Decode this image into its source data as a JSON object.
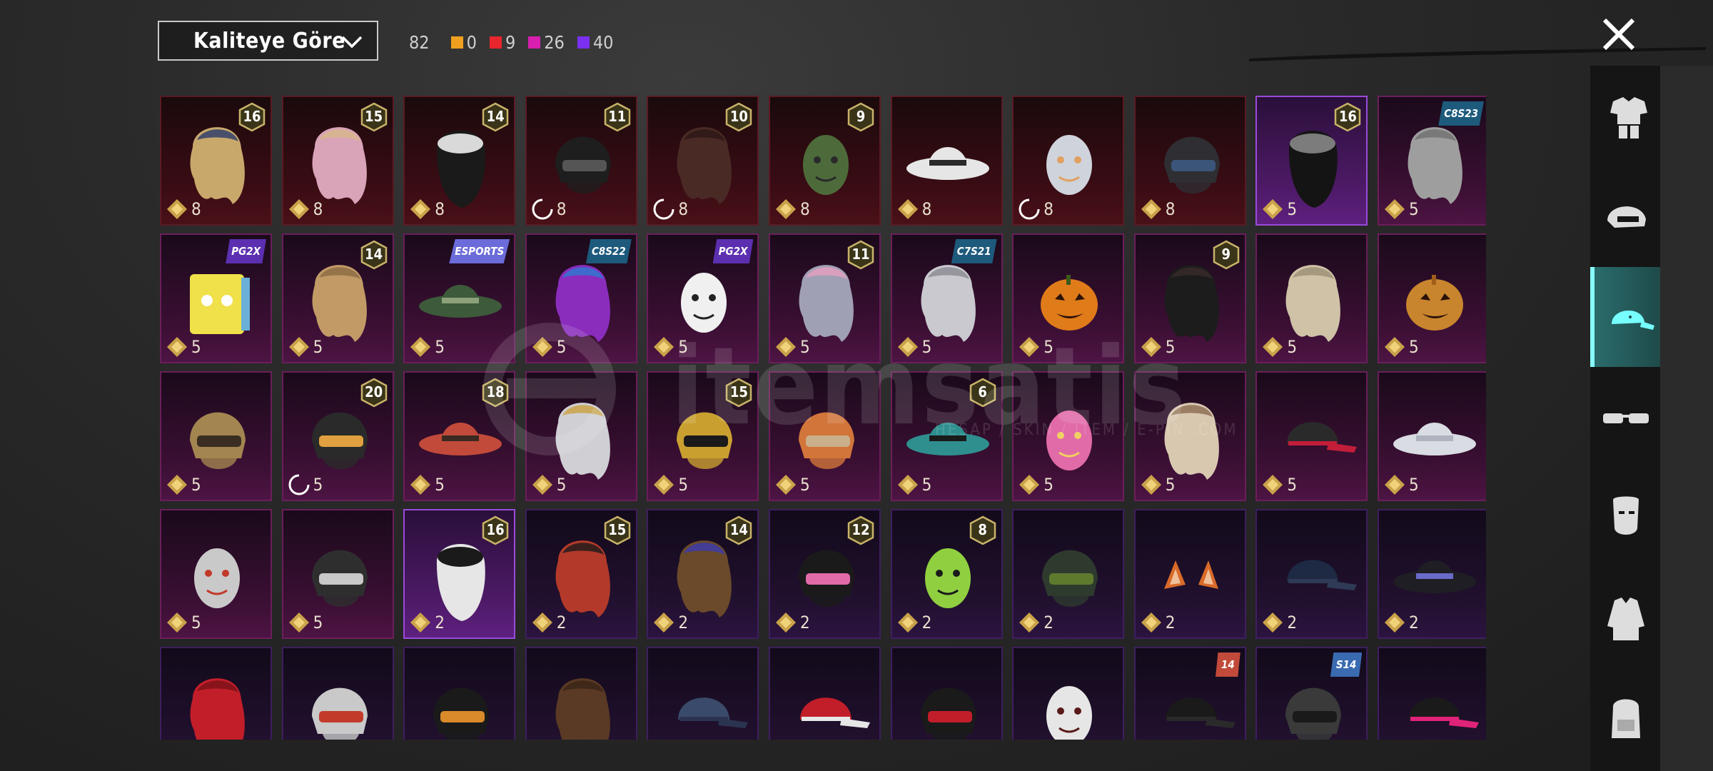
{
  "sort": {
    "label": "Kaliteye Göre"
  },
  "counts": {
    "total": "82",
    "qualities": [
      {
        "color": "#f0a020",
        "value": "0"
      },
      {
        "color": "#e8262c",
        "value": "9"
      },
      {
        "color": "#d81fb0",
        "value": "26"
      },
      {
        "color": "#7b2ff0",
        "value": "40"
      }
    ]
  },
  "watermark": {
    "text": "itemsatis",
    "sub": "HESAP / SKIN / İTEM / E-PİN .COM"
  },
  "sidebar": [
    {
      "icon": "outfit-icon",
      "active": false
    },
    {
      "icon": "helmet-icon",
      "active": false
    },
    {
      "icon": "cap-icon",
      "active": true
    },
    {
      "icon": "glasses-icon",
      "active": false
    },
    {
      "icon": "mask-icon",
      "active": false
    },
    {
      "icon": "jacket-icon",
      "active": false
    },
    {
      "icon": "backpack-icon",
      "active": false
    }
  ],
  "items": [
    {
      "name": "aviator-goggles-hair",
      "rarity": "red",
      "badge": "16",
      "price": "8",
      "art": "hair",
      "c1": "#c9a86b",
      "c2": "#2b3a6b"
    },
    {
      "name": "pink-long-hair",
      "rarity": "red",
      "badge": "15",
      "price": "8",
      "art": "hair",
      "c1": "#d9a3b8",
      "c2": "#d7b88a"
    },
    {
      "name": "wolf-ear-hood",
      "rarity": "red",
      "badge": "14",
      "price": "8",
      "art": "hood",
      "c1": "#1a1a1a",
      "c2": "#d9d9d9"
    },
    {
      "name": "black-helmet",
      "rarity": "red",
      "badge": "11",
      "price": "8",
      "art": "helmet",
      "c1": "#1e1e1e",
      "c2": "#555",
      "loading": true
    },
    {
      "name": "dark-dread-hair",
      "rarity": "red",
      "badge": "10",
      "price": "8",
      "art": "hair",
      "c1": "#4a2a25",
      "c2": "#2a1714",
      "loading": true
    },
    {
      "name": "zombie-head",
      "rarity": "red",
      "badge": "9",
      "price": "8",
      "art": "face",
      "c1": "#4d6b3a",
      "c2": "#2a2a2a"
    },
    {
      "name": "white-cowboy-hat",
      "rarity": "red",
      "badge": "",
      "price": "8",
      "art": "hat",
      "c1": "#e6e6e6",
      "c2": "#2b2b2b"
    },
    {
      "name": "shark-crown",
      "rarity": "red",
      "badge": "",
      "price": "8",
      "art": "face",
      "c1": "#cfd3db",
      "c2": "#e0a060",
      "loading": true
    },
    {
      "name": "dark-visor-helmet",
      "rarity": "red",
      "badge": "",
      "price": "8",
      "art": "helmet",
      "c1": "#2e2e33",
      "c2": "#3b5578"
    },
    {
      "name": "officer-cap-hair",
      "rarity": "purple-sel",
      "badge": "16",
      "price": "5",
      "art": "hood",
      "c1": "#141414",
      "c2": "#7c7c7c"
    },
    {
      "name": "grey-bob-hair",
      "rarity": "magenta",
      "tag": "C8S23",
      "tagColor": "#1d5a7c",
      "price": "5",
      "art": "hair",
      "c1": "#9e9e9e",
      "c2": "#6f6f6f"
    },
    {
      "name": "pop-box-head",
      "rarity": "magenta",
      "tag": "PG2X",
      "tagColor": "#5c2fb0",
      "price": "5",
      "art": "box",
      "c1": "#f0e04a",
      "c2": "#6ab0d8"
    },
    {
      "name": "blonde-wavy-hair",
      "rarity": "magenta",
      "badge": "14",
      "price": "5",
      "art": "hair",
      "c1": "#c19a66",
      "c2": "#8b6a44"
    },
    {
      "name": "camo-bucket-hat",
      "rarity": "magenta",
      "tag": "ESPORTS",
      "tagColor": "#6b6bd9",
      "price": "5",
      "art": "hat",
      "c1": "#3d5a3a",
      "c2": "#8ca07a"
    },
    {
      "name": "neon-bob-hair",
      "rarity": "magenta",
      "tag": "C8S22",
      "tagColor": "#1d5a7c",
      "price": "5",
      "art": "hair",
      "c1": "#8a2dbd",
      "c2": "#2a7ad1"
    },
    {
      "name": "panda-head",
      "rarity": "magenta",
      "tag": "PG2X",
      "tagColor": "#5c2fb0",
      "price": "5",
      "art": "face",
      "c1": "#f0f0f0",
      "c2": "#222"
    },
    {
      "name": "flower-crown-hair",
      "rarity": "magenta",
      "badge": "11",
      "price": "5",
      "art": "hair",
      "c1": "#a0a0b5",
      "c2": "#e6a0c0"
    },
    {
      "name": "silver-short-hair",
      "rarity": "magenta",
      "tag": "C7S21",
      "tagColor": "#1d5a7c",
      "price": "5",
      "art": "hair",
      "c1": "#c9c9cf",
      "c2": "#8a8a92"
    },
    {
      "name": "pumpkin-head",
      "rarity": "magenta",
      "price": "5",
      "art": "pumpkin",
      "c1": "#e07b1a",
      "c2": "#3b5a1a"
    },
    {
      "name": "black-ponytail",
      "rarity": "magenta",
      "badge": "9",
      "price": "5",
      "art": "hair",
      "c1": "#1c1c1c",
      "c2": "#3a2a2a"
    },
    {
      "name": "braided-blonde-hair",
      "rarity": "magenta",
      "price": "5",
      "art": "hair",
      "c1": "#cfc2a6",
      "c2": "#9a8e76"
    },
    {
      "name": "potato-head",
      "rarity": "magenta",
      "price": "5",
      "art": "pumpkin",
      "c1": "#c9852e",
      "c2": "#a15e18"
    },
    {
      "name": "golden-horned-helmet",
      "rarity": "magenta",
      "price": "5",
      "art": "helmet",
      "c1": "#a38550",
      "c2": "#3a2e22"
    },
    {
      "name": "monkey-king-helmet",
      "rarity": "magenta",
      "badge": "20",
      "price": "5",
      "art": "helmet",
      "c1": "#2a2a2a",
      "c2": "#e0a040",
      "loading": true
    },
    {
      "name": "feather-headdress",
      "rarity": "magenta",
      "badge": "18",
      "price": "5",
      "art": "hat",
      "c1": "#c24a3a",
      "c2": "#3a2a22"
    },
    {
      "name": "crowned-white-hair",
      "rarity": "magenta",
      "price": "5",
      "art": "hair",
      "c1": "#cfcfd4",
      "c2": "#c9a040"
    },
    {
      "name": "golden-robot-helmet",
      "rarity": "magenta",
      "badge": "15",
      "price": "5",
      "art": "helmet",
      "c1": "#c9a030",
      "c2": "#1a1a1a"
    },
    {
      "name": "orange-horn-helmet",
      "rarity": "magenta",
      "price": "5",
      "art": "helmet",
      "c1": "#d2753a",
      "c2": "#c9b08a"
    },
    {
      "name": "teal-tree-hat",
      "rarity": "magenta",
      "badge": "6",
      "price": "5",
      "art": "hat",
      "c1": "#2f8f8f",
      "c2": "#1a1a1a"
    },
    {
      "name": "pink-bunny-head",
      "rarity": "magenta",
      "price": "5",
      "art": "face",
      "c1": "#e16aa8",
      "c2": "#f0d060"
    },
    {
      "name": "cream-fluffy-hair",
      "rarity": "magenta",
      "price": "5",
      "art": "hair",
      "c1": "#d9c8b0",
      "c2": "#8a6a50"
    },
    {
      "name": "red-beanie-cap",
      "rarity": "magenta",
      "price": "5",
      "art": "cap",
      "c1": "#2a2a2a",
      "c2": "#c21e3a"
    },
    {
      "name": "white-sun-hat",
      "rarity": "magenta",
      "price": "5",
      "art": "hat",
      "c1": "#d9dce3",
      "c2": "#aeb3bd"
    },
    {
      "name": "chicken-head",
      "rarity": "magenta",
      "price": "5",
      "art": "face",
      "c1": "#c9c9c9",
      "c2": "#c23a2a"
    },
    {
      "name": "skull-mask-helmet",
      "rarity": "magenta",
      "price": "5",
      "art": "helmet",
      "c1": "#2e2e2e",
      "c2": "#c9c9c9"
    },
    {
      "name": "bandana-mohawk",
      "rarity": "purple-sel",
      "badge": "16",
      "price": "2",
      "art": "hood",
      "c1": "#e6e6e6",
      "c2": "#1a1a1a"
    },
    {
      "name": "red-hair-hood",
      "rarity": "purple",
      "badge": "15",
      "price": "2",
      "art": "hair",
      "c1": "#b33a2a",
      "c2": "#1a1a1a"
    },
    {
      "name": "cat-ear-cap-hair",
      "rarity": "purple",
      "badge": "14",
      "price": "2",
      "art": "hair",
      "c1": "#6a4a2a",
      "c2": "#3a3ab0"
    },
    {
      "name": "bunny-ear-helmet",
      "rarity": "purple",
      "badge": "12",
      "price": "2",
      "art": "helmet",
      "c1": "#1a1a1a",
      "c2": "#e16aa8"
    },
    {
      "name": "green-skull-hood",
      "rarity": "purple",
      "badge": "8",
      "price": "2",
      "art": "face",
      "c1": "#90d040",
      "c2": "#1a1a1a"
    },
    {
      "name": "gas-mask-helmet",
      "rarity": "purple",
      "price": "2",
      "art": "helmet",
      "c1": "#2e3a2e",
      "c2": "#5e7a2e"
    },
    {
      "name": "fox-ears",
      "rarity": "purple",
      "price": "2",
      "art": "ears",
      "c1": "#d96a2a",
      "c2": "#f0c09a"
    },
    {
      "name": "navy-beanie",
      "rarity": "purple",
      "price": "2",
      "art": "cap",
      "c1": "#1e2a44",
      "c2": "#2e3a56"
    },
    {
      "name": "witch-hat",
      "rarity": "purple",
      "price": "2",
      "art": "hat",
      "c1": "#1e1e24",
      "c2": "#6a6ac9"
    },
    {
      "name": "red-mohawk",
      "rarity": "purple",
      "price": "",
      "art": "hair",
      "c1": "#c21e2a",
      "c2": "#7a1018"
    },
    {
      "name": "racer-helmet",
      "rarity": "purple",
      "price": "",
      "art": "helmet",
      "c1": "#c9c9c9",
      "c2": "#c23a2a"
    },
    {
      "name": "orange-braid-helmet",
      "rarity": "purple",
      "price": "",
      "art": "helmet",
      "c1": "#1a1a1a",
      "c2": "#d98a2a"
    },
    {
      "name": "brown-bun-hair",
      "rarity": "purple",
      "price": "",
      "art": "hair",
      "c1": "#5a3a24",
      "c2": "#3a2416"
    },
    {
      "name": "navy-baseball-cap",
      "rarity": "purple",
      "price": "",
      "art": "cap",
      "c1": "#3a4a6a",
      "c2": "#2a3450"
    },
    {
      "name": "red-white-cap",
      "rarity": "purple",
      "price": "",
      "art": "cap",
      "c1": "#c21e2a",
      "c2": "#e6e6e6"
    },
    {
      "name": "moto-helmet",
      "rarity": "purple",
      "price": "",
      "art": "helmet",
      "c1": "#1a1a1a",
      "c2": "#c21e2a"
    },
    {
      "name": "joker-face",
      "rarity": "purple",
      "price": "",
      "art": "face",
      "c1": "#e6e6e6",
      "c2": "#5a1a1a"
    },
    {
      "name": "police-cap",
      "rarity": "purple",
      "tag": "14",
      "tagColor": "#c24a3a",
      "price": "",
      "art": "cap",
      "c1": "#1a1a1a",
      "c2": "#2a2a2a"
    },
    {
      "name": "spartan-helmet",
      "rarity": "purple",
      "tag": "S14",
      "tagColor": "#3a6ab0",
      "price": "",
      "art": "helmet",
      "c1": "#3a3a3a",
      "c2": "#1a1a1a"
    },
    {
      "name": "pink-black-cap",
      "rarity": "purple",
      "price": "",
      "art": "cap",
      "c1": "#1a1a1a",
      "c2": "#e0237a"
    }
  ]
}
